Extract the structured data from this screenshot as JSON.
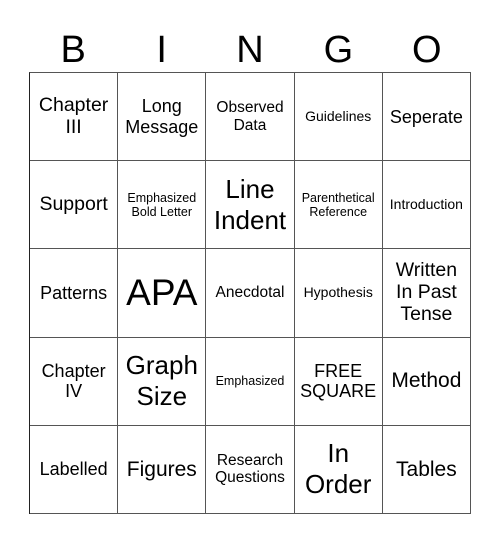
{
  "header": [
    "B",
    "I",
    "N",
    "G",
    "O"
  ],
  "cells": [
    [
      "Chapter\nIII",
      "Long\nMessage",
      "Observed\nData",
      "Guidelines",
      "Seperate"
    ],
    [
      "Support",
      "Emphasized\nBold Letter",
      "Line\nIndent",
      "Parenthetical\nReference",
      "Introduction"
    ],
    [
      "Patterns",
      "APA",
      "Anecdotal",
      "Hypothesis",
      "Written\nIn Past\nTense"
    ],
    [
      "Chapter\nIV",
      "Graph\nSize",
      "Emphasized",
      "FREE\nSQUARE",
      "Method"
    ],
    [
      "Labelled",
      "Figures",
      "Research\nQuestions",
      "In\nOrder",
      "Tables"
    ]
  ]
}
